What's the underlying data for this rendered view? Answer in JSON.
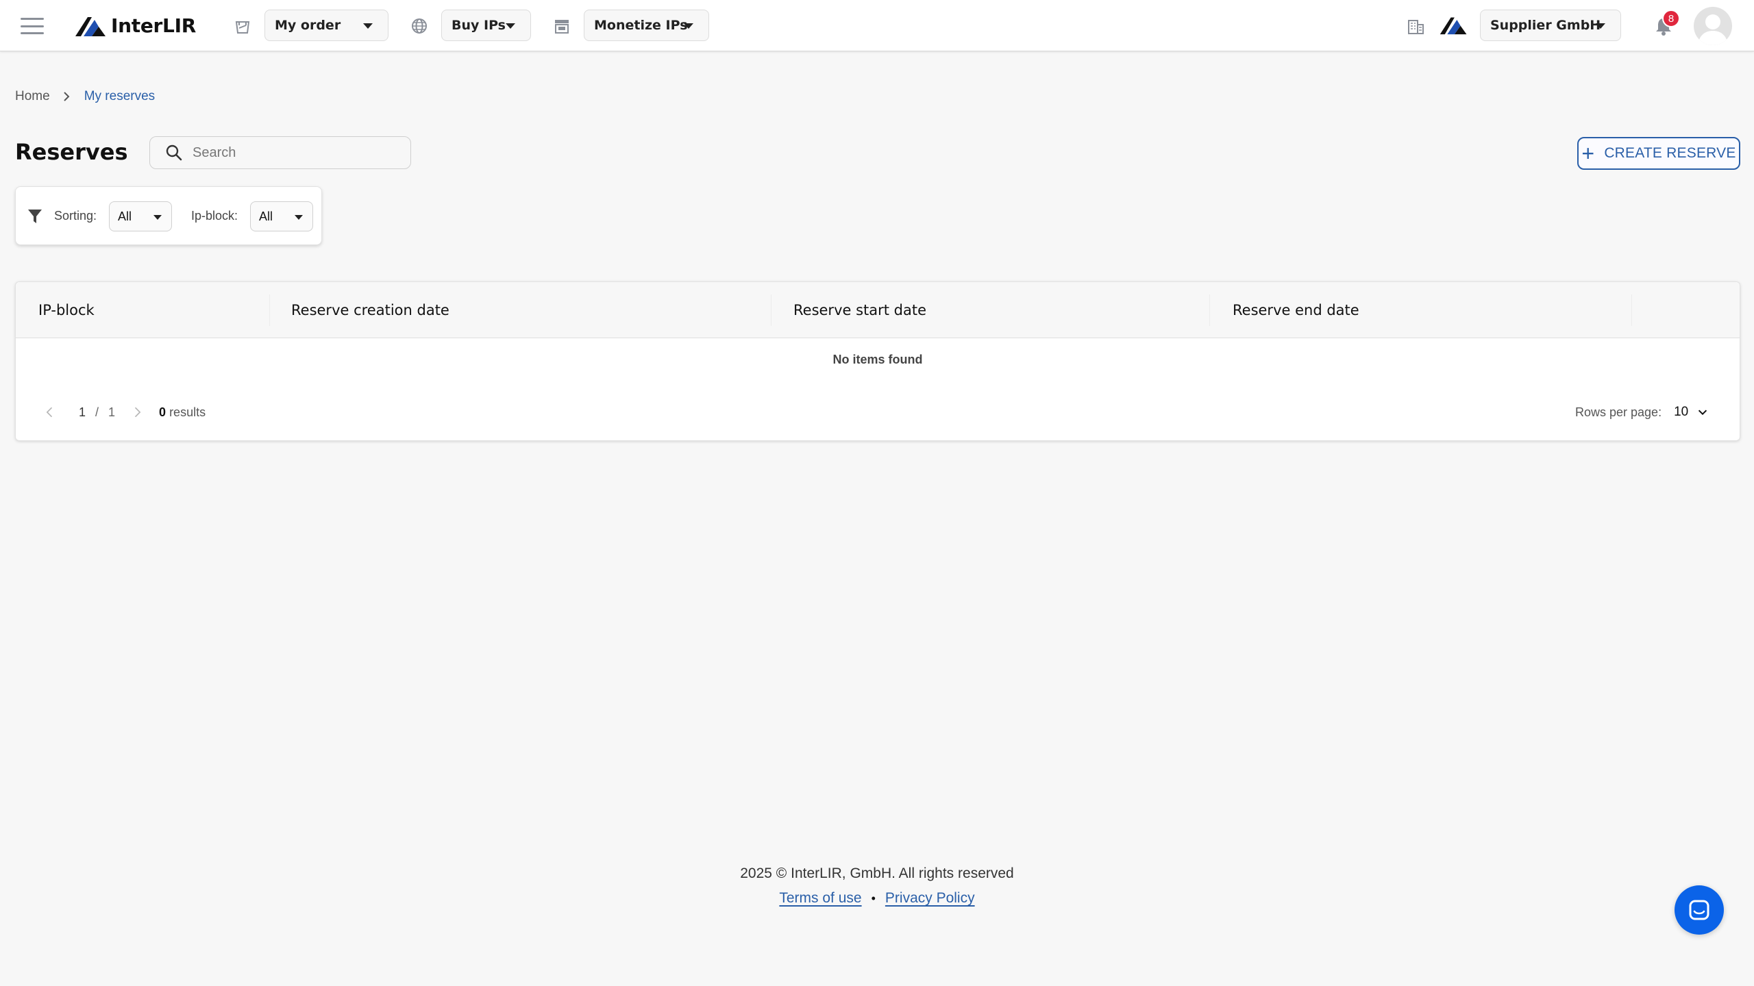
{
  "app": {
    "brand": "InterLIR"
  },
  "topbar": {
    "my_order": "My order",
    "buy_ips": "Buy IPs",
    "monetize_ips": "Monetize IPs",
    "company": "Supplier GmbH",
    "notifications_count": "8"
  },
  "breadcrumb": {
    "home": "Home",
    "current": "My reserves"
  },
  "page": {
    "title": "Reserves",
    "search_placeholder": "Search",
    "create_button": "CREATE RESERVE"
  },
  "filters": {
    "sorting_label": "Sorting:",
    "sorting_value": "All",
    "ipblock_label": "Ip-block:",
    "ipblock_value": "All"
  },
  "table": {
    "columns": [
      "IP-block",
      "Reserve creation date",
      "Reserve start date",
      "Reserve end date"
    ],
    "empty_text": "No items found",
    "pagination": {
      "current_page": "1",
      "separator": "/",
      "total_pages": "1",
      "results_count": "0",
      "results_label": "results",
      "rows_per_page_label": "Rows per page:",
      "rows_per_page_value": "10"
    }
  },
  "footer": {
    "copyright": "2025 © InterLIR, GmbH. All rights reserved",
    "terms": "Terms of use",
    "bullet": "•",
    "privacy": "Privacy Policy"
  },
  "colors": {
    "accent": "#2a5fa8",
    "badge": "#e0263d",
    "chat": "#0b63e8",
    "background": "#f7f7f7"
  }
}
